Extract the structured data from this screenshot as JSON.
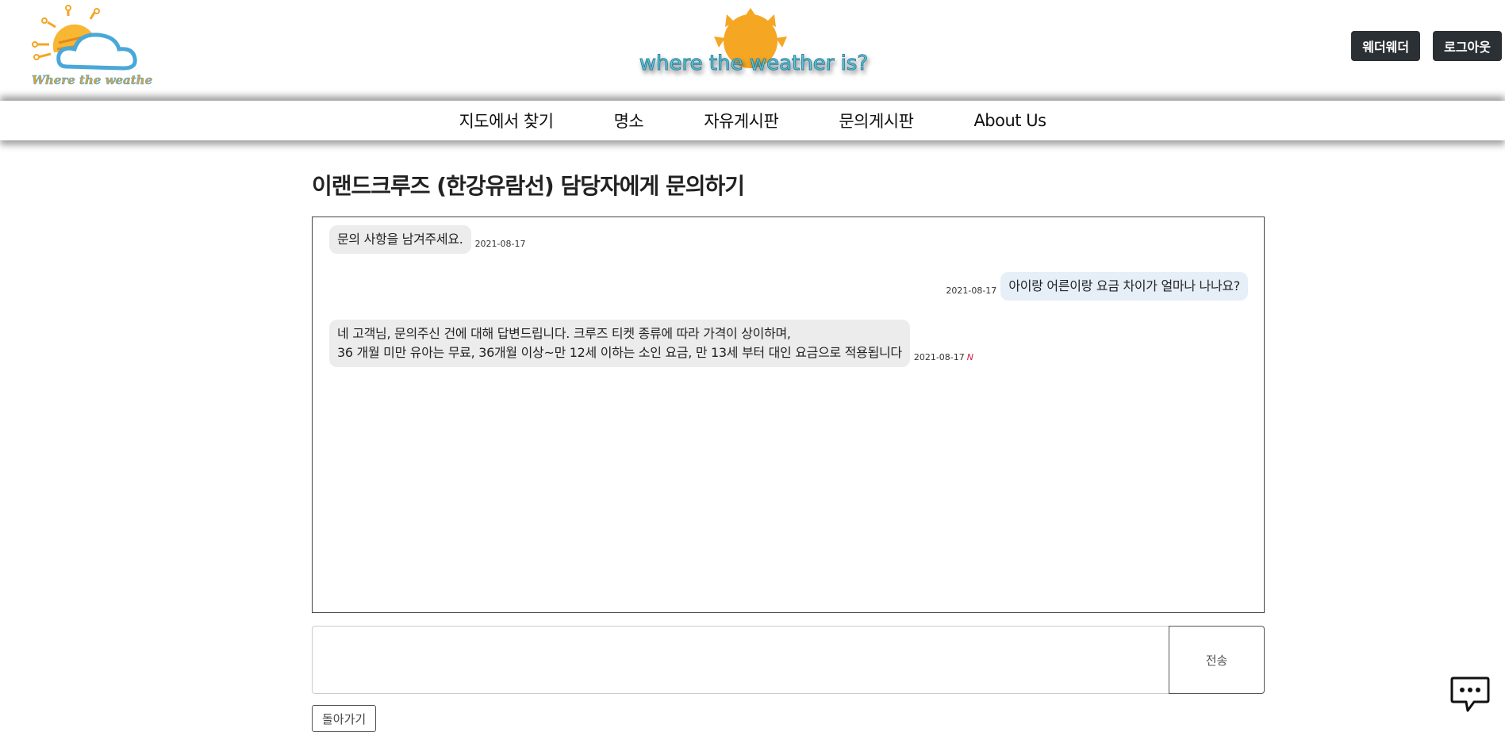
{
  "header": {
    "left_logo_text": "Where the weather is",
    "center_logo_text": "where the weather is?",
    "user_button_label": "웨더웨더",
    "logout_button_label": "로그아웃"
  },
  "nav": {
    "items": [
      {
        "label": "지도에서 찾기"
      },
      {
        "label": "명소"
      },
      {
        "label": "자유게시판"
      },
      {
        "label": "문의게시판"
      },
      {
        "label": "About Us"
      }
    ]
  },
  "page": {
    "title": "이랜드크루즈 (한강유람선) 담당자에게 문의하기"
  },
  "messages": [
    {
      "text": "문의 사항을 남겨주세요.",
      "date": "2021-08-17"
    },
    {
      "text": "아이랑 어른이랑 요금 차이가 얼마나 나나요?",
      "date": "2021-08-17"
    },
    {
      "line1": "네 고객님, 문의주신 건에 대해 답변드립니다. 크루즈 티켓 종류에 따라 가격이 상이하며,",
      "line2": "36 개월 미만 유아는 무료, 36개월 이상~만 12세 이하는 소인 요금, 만 13세 부터 대인 요금으로 적용됩니다",
      "date": "2021-08-17",
      "badge": "N"
    }
  ],
  "composer": {
    "value": "",
    "send_label": "전송"
  },
  "back_label": "돌아가기",
  "colors": {
    "button_dark": "#2b3035",
    "bubble_other": "#ececec",
    "bubble_mine": "#e6eef8",
    "new_badge": "#d0204a",
    "logo_orange": "#f5a623",
    "logo_blue": "#4aa8d8"
  },
  "icons": {
    "chat_fab": "chat-bubble-dots-icon"
  }
}
